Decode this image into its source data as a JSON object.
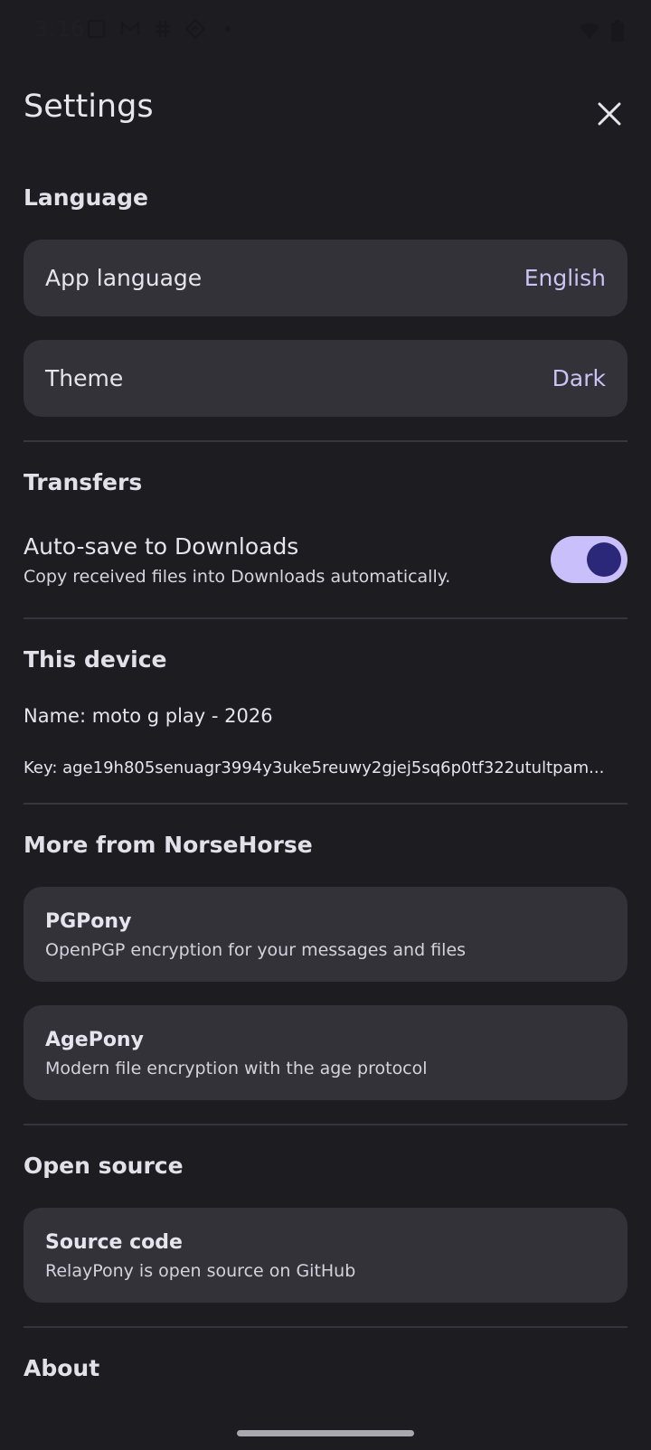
{
  "status_bar": {
    "time": "3:16",
    "left_icons": [
      "notes-icon",
      "gmail-icon",
      "slack-icon",
      "navigation-icon",
      "dot-icon"
    ],
    "right_icons": [
      "wifi-icon",
      "battery-icon"
    ]
  },
  "header": {
    "title": "Settings",
    "close_icon": "close-icon"
  },
  "language_section": {
    "title": "Language",
    "app_language": {
      "label": "App language",
      "value": "English"
    },
    "theme": {
      "label": "Theme",
      "value": "Dark"
    }
  },
  "transfers_section": {
    "title": "Transfers",
    "auto_save": {
      "label": "Auto-save to Downloads",
      "description": "Copy received files into Downloads automatically.",
      "enabled": true
    }
  },
  "device_section": {
    "title": "This device",
    "name": "Name: moto g play - 2026",
    "key": "Key: age19h805senuagr3994y3uke5reuwy2gjej5sq6p0tf322utultpam..."
  },
  "more_section": {
    "title": "More from NorseHorse",
    "items": [
      {
        "title": "PGPony",
        "subtitle": "OpenPGP encryption for your messages and files"
      },
      {
        "title": "AgePony",
        "subtitle": "Modern file encryption with the age protocol"
      }
    ]
  },
  "open_source_section": {
    "title": "Open source",
    "source_code": {
      "title": "Source code",
      "subtitle": "RelayPony is open source on GitHub"
    }
  },
  "about_section": {
    "title": "About"
  },
  "colors": {
    "background": "#1c1c21",
    "card": "#333239",
    "accent": "#cbc2f6",
    "toggle_track": "#c9c0fb",
    "toggle_knob": "#2b2879"
  }
}
